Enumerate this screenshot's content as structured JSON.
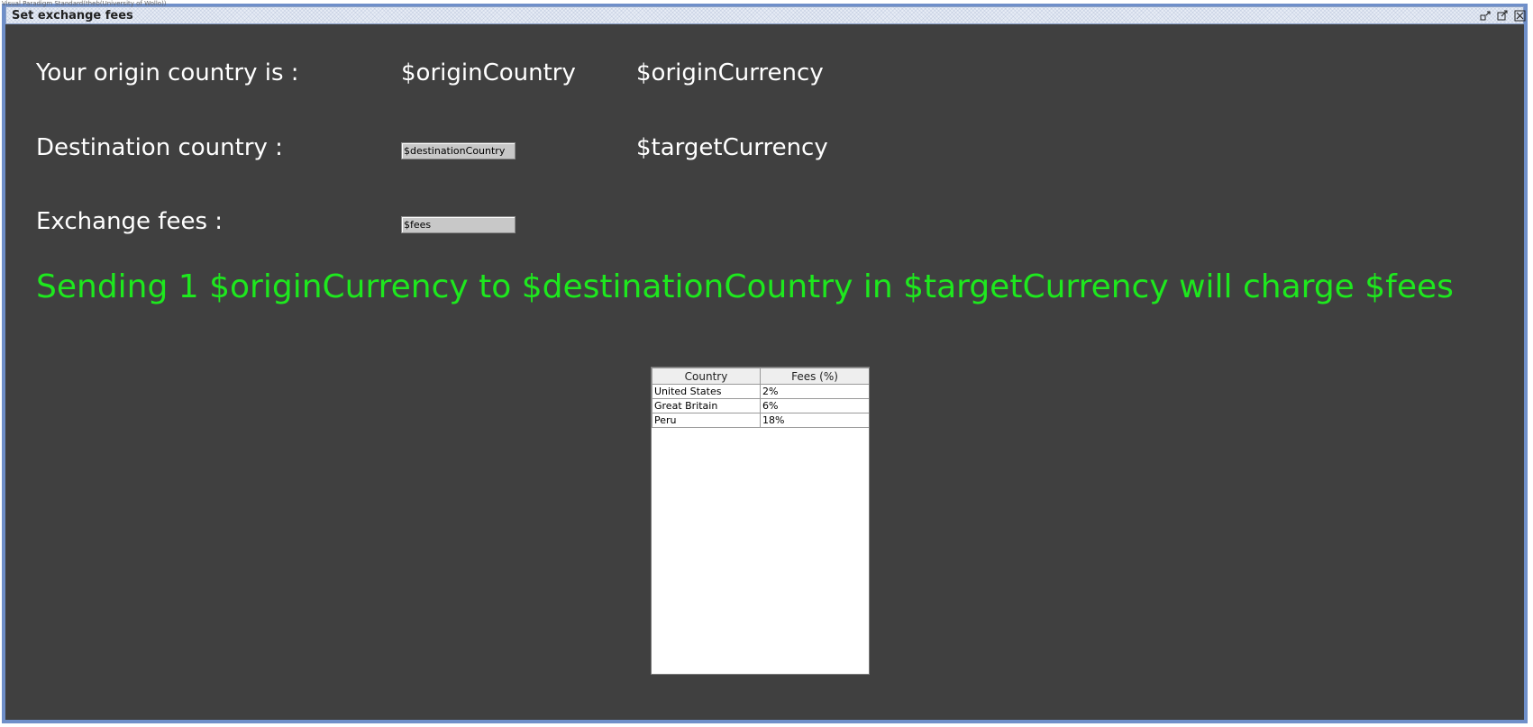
{
  "watermark": "Visual Paradigm Standard(theb(University of Wollo))",
  "window": {
    "title": "Set exchange fees",
    "buttons": {
      "minimize_icon": "minimize-icon",
      "maximize_icon": "maximize-icon",
      "close_icon": "close-icon"
    }
  },
  "form": {
    "origin_label": "Your origin country is :",
    "origin_country": "$originCountry",
    "origin_currency": "$originCurrency",
    "destination_label": "Destination country :",
    "destination_field": "$destinationCountry",
    "target_currency": "$targetCurrency",
    "fees_label": "Exchange fees :",
    "fees_field": "$fees"
  },
  "summary": "Sending 1 $originCurrency to $destinationCountry in $targetCurrency will charge $fees",
  "table": {
    "headers": [
      "Country",
      "Fees (%)"
    ],
    "rows": [
      {
        "country": "United States",
        "fees": "2%"
      },
      {
        "country": "Great Britain",
        "fees": "6%"
      },
      {
        "country": "Peru",
        "fees": "18%"
      }
    ]
  },
  "colors": {
    "background": "#404040",
    "summary_text": "#1ee81e",
    "frame": "#6f8fc9"
  }
}
